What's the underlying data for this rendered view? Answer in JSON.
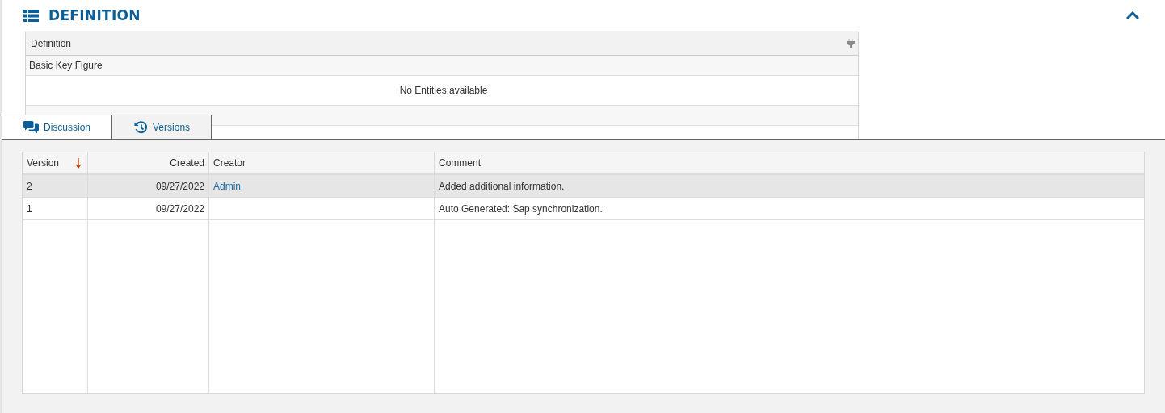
{
  "section": {
    "title": "DEFINITION",
    "expanded": true
  },
  "definition_table": {
    "header": "Definition",
    "rows": [
      {
        "kind": "group",
        "label": "Basic Key Figure"
      },
      {
        "kind": "empty",
        "label": "No Entities available"
      }
    ]
  },
  "tabs": [
    {
      "kind": "discussion",
      "label": "Discussion",
      "selected": false
    },
    {
      "kind": "versions",
      "label": "Versions",
      "selected": true
    }
  ],
  "versions_table": {
    "columns": [
      {
        "label": "Version",
        "sorted": true
      },
      {
        "label": "Created",
        "sorted": false
      },
      {
        "label": "Creator",
        "sorted": false
      },
      {
        "label": "Comment",
        "sorted": false
      }
    ],
    "rows": [
      {
        "version": "2",
        "created": "09/27/2022",
        "creator": "Admin",
        "comment": "Added additional information.",
        "selected": true
      },
      {
        "version": "1",
        "created": "09/27/2022",
        "comment": "Auto Generated: Sap synchronization.",
        "selected": false
      }
    ]
  }
}
